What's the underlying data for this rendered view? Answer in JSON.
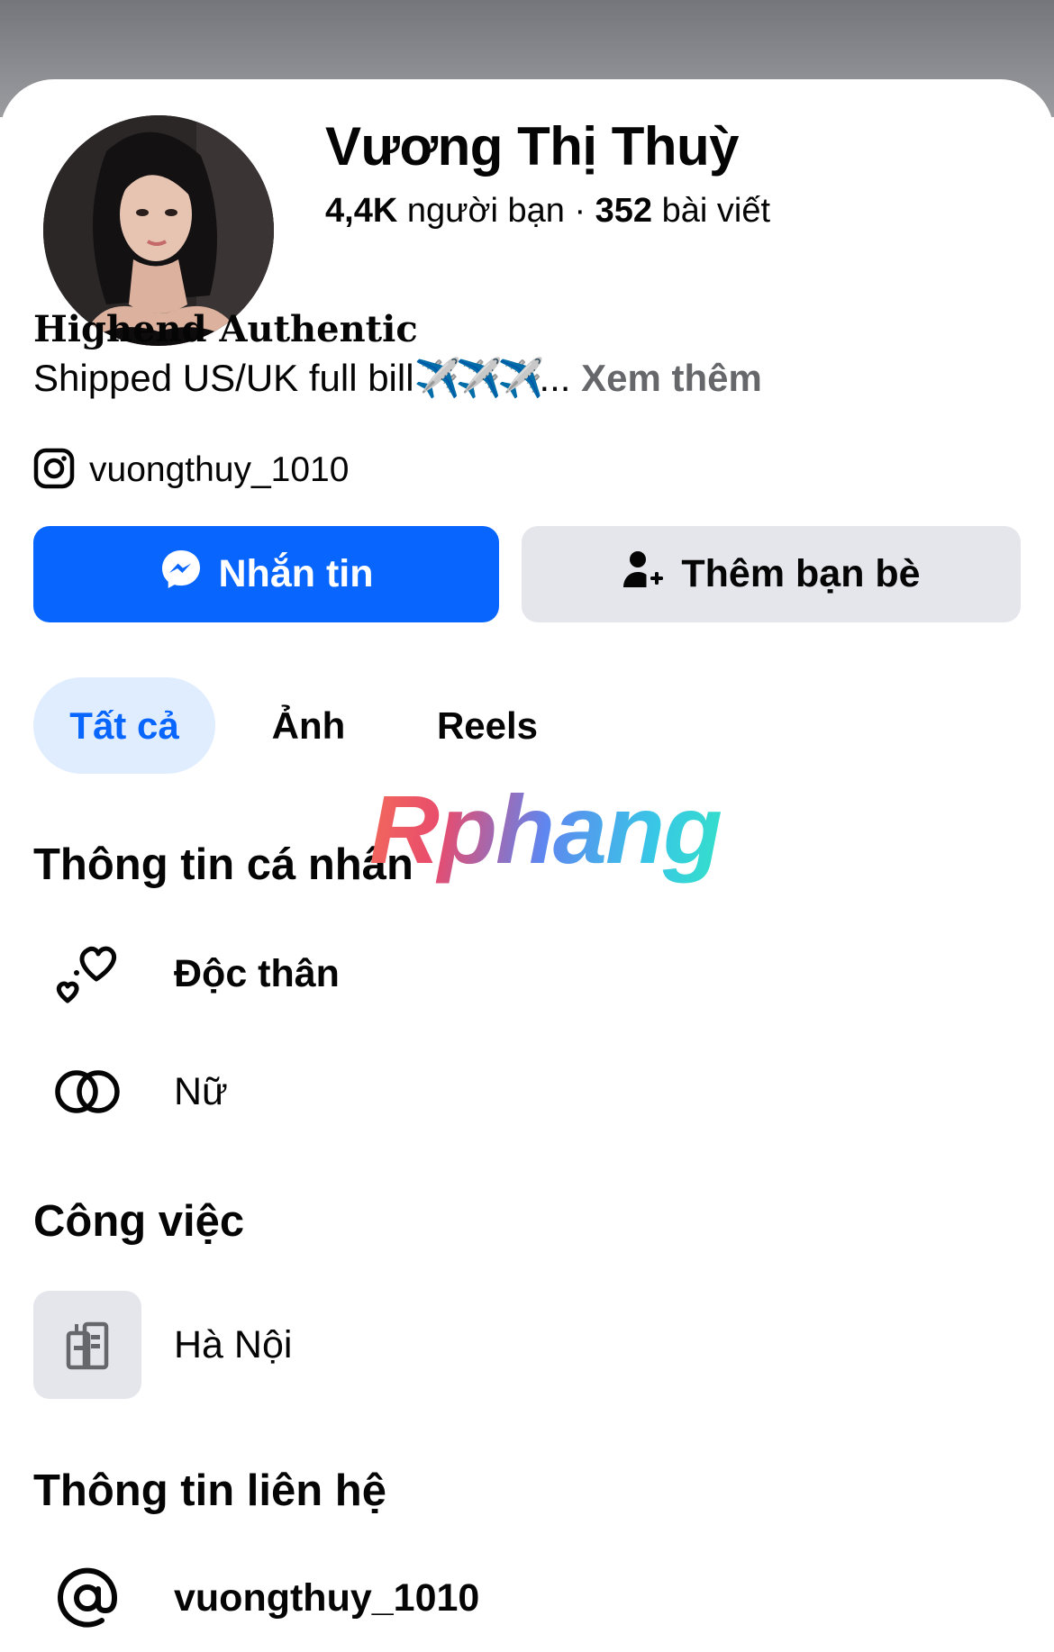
{
  "profile": {
    "name": "Vương Thị Thuỳ",
    "friends_count": "4,4K",
    "friends_label": "người bạn",
    "separator": "·",
    "posts_count": "352",
    "posts_label": "bài viết"
  },
  "bio": {
    "title": "Highend Authentic",
    "text": "Shipped US/UK full bill",
    "emojis": "✈️✈️✈️",
    "ellipsis": "...",
    "see_more": "Xem thêm"
  },
  "instagram": {
    "icon": "instagram-icon",
    "handle": "vuongthuy_1010"
  },
  "actions": {
    "message_label": "Nhắn tin",
    "add_friend_label": "Thêm bạn bè"
  },
  "tabs": [
    {
      "label": "Tất cả",
      "active": true
    },
    {
      "label": "Ảnh",
      "active": false
    },
    {
      "label": "Reels",
      "active": false
    }
  ],
  "watermark": "Rphang",
  "sections": {
    "personal": {
      "title": "Thông tin cá nhân",
      "relationship": "Độc thân",
      "gender": "Nữ"
    },
    "work": {
      "title": "Công việc",
      "place": "Hà Nội"
    },
    "contact": {
      "title": "Thông tin liên hệ",
      "handle": "vuongthuy_1010"
    }
  },
  "colors": {
    "primary": "#0866ff",
    "secondary_button": "#e4e6eb",
    "active_tab_bg": "#e0edff",
    "muted_text": "#65676b"
  }
}
